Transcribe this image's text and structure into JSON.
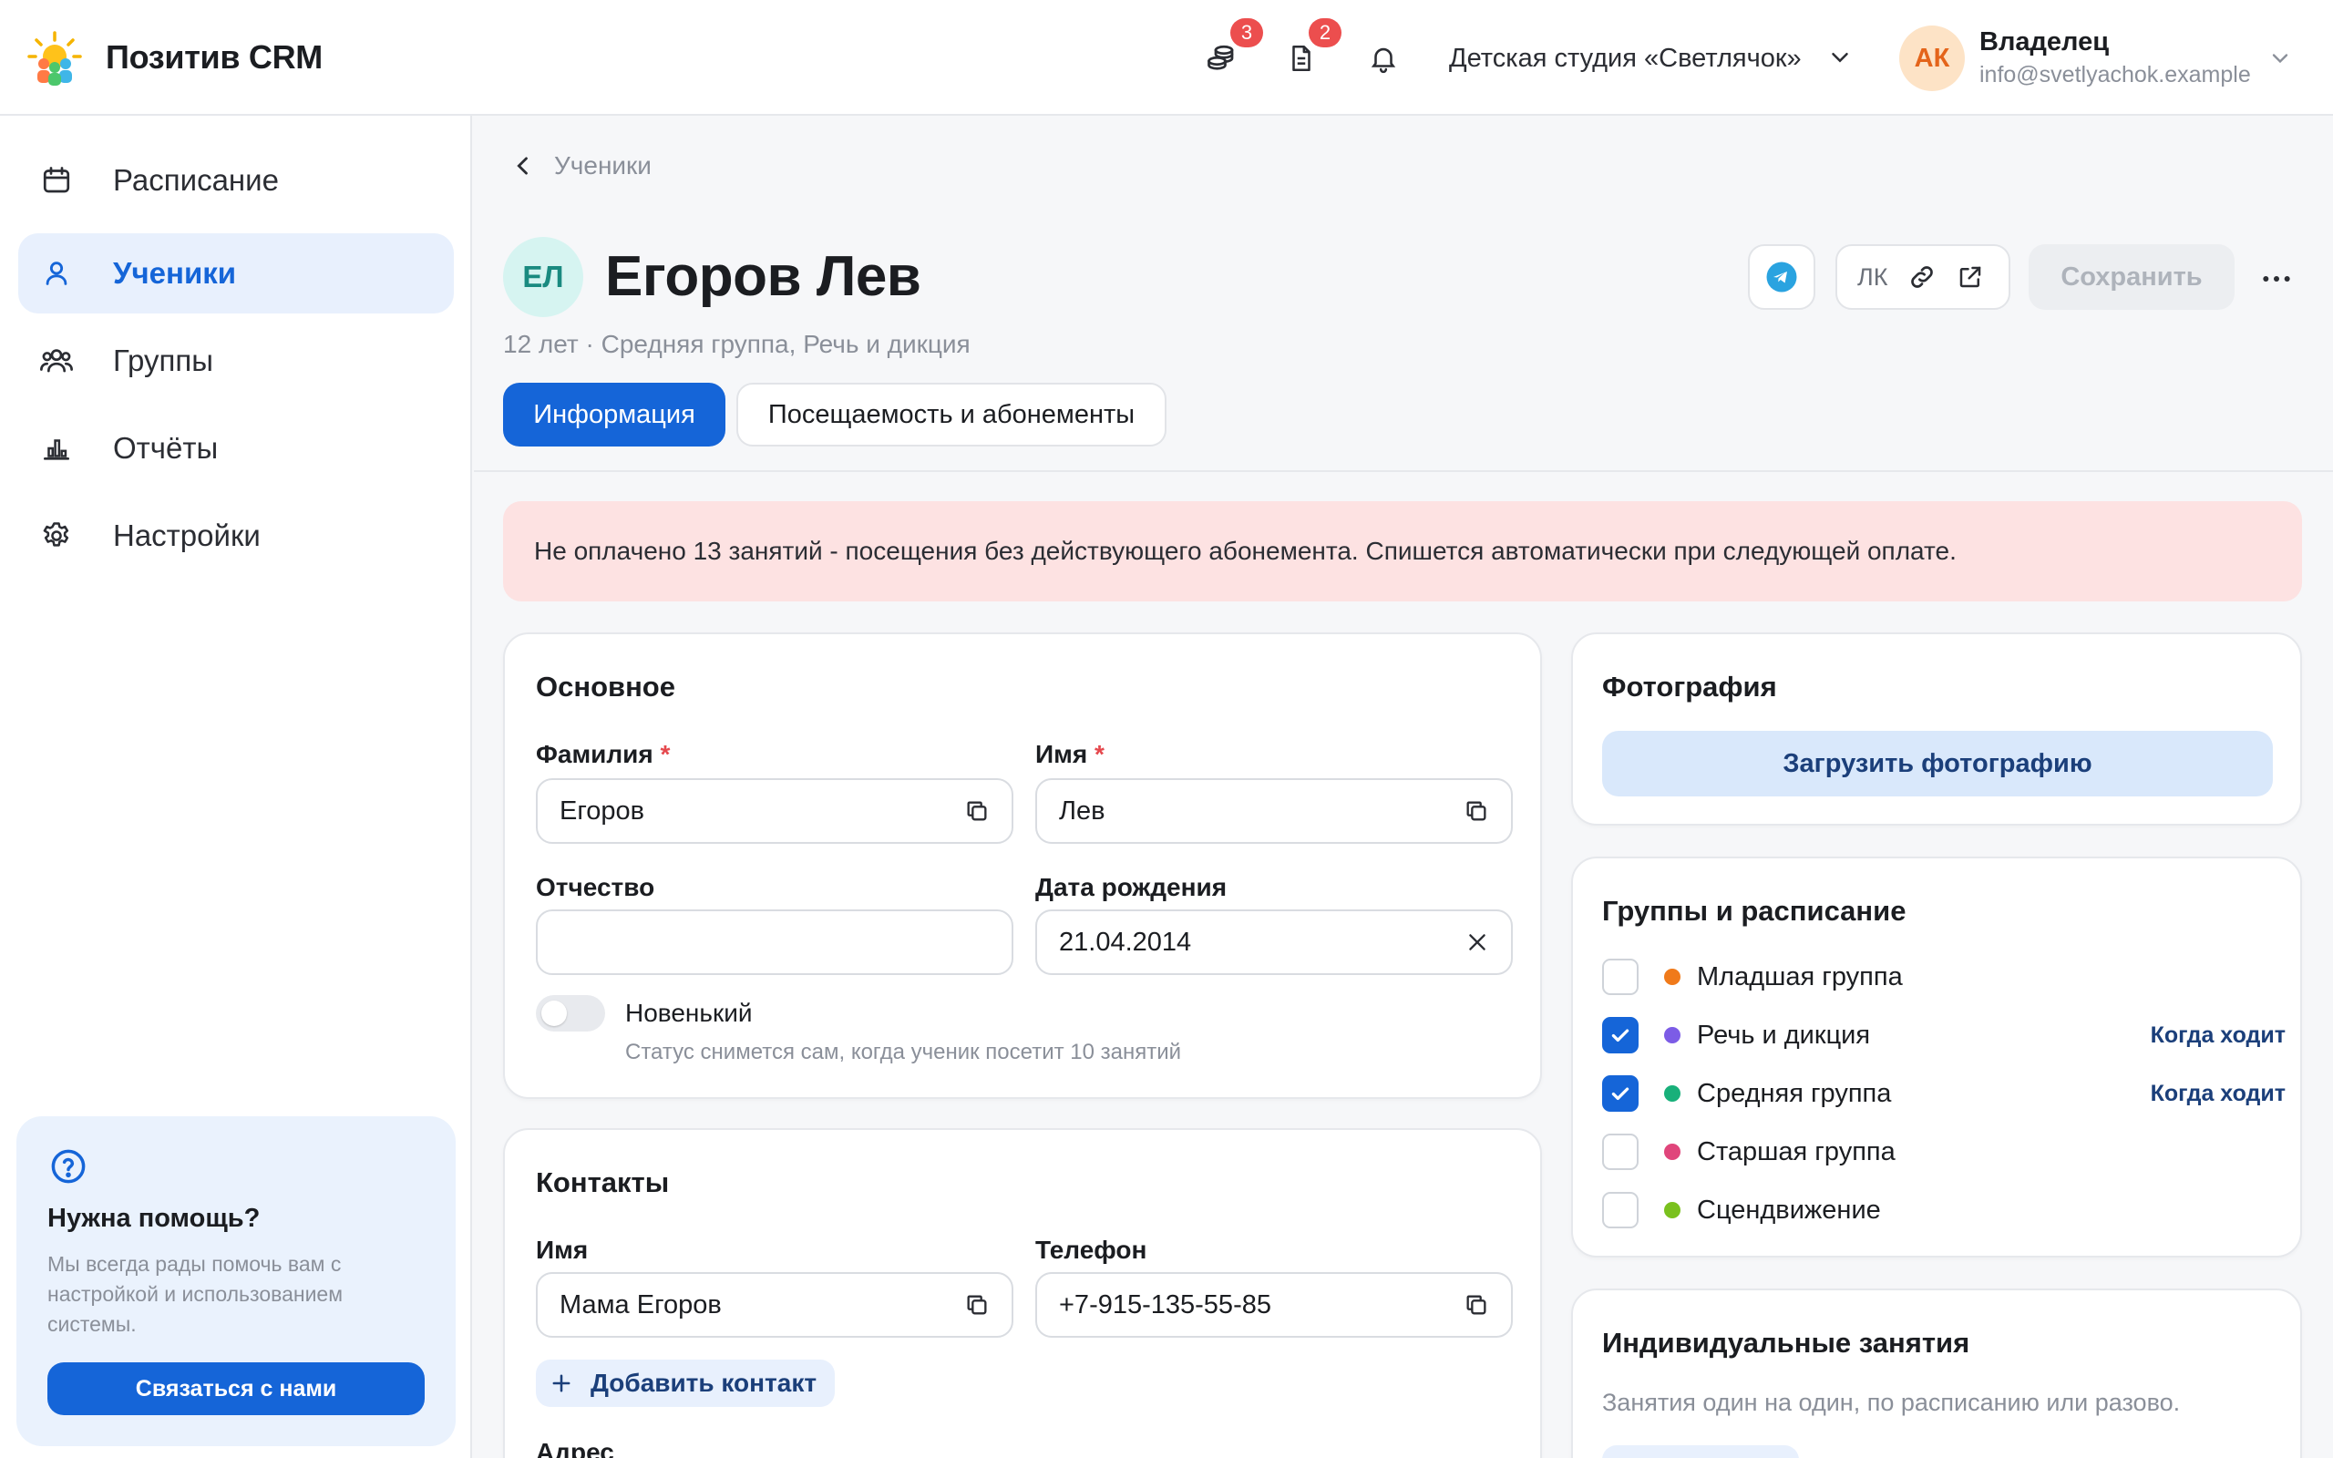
{
  "app": {
    "name": "Позитив CRM"
  },
  "header": {
    "finance_badge": "3",
    "docs_badge": "2",
    "org_name": "Детская студия «Светлячок»",
    "user": {
      "initials": "АК",
      "role": "Владелец",
      "email": "info@svetlyachok.example"
    }
  },
  "sidebar": {
    "items": [
      {
        "label": "Расписание",
        "icon": "calendar-icon"
      },
      {
        "label": "Ученики",
        "icon": "user-icon",
        "active": true
      },
      {
        "label": "Группы",
        "icon": "users-icon"
      },
      {
        "label": "Отчёты",
        "icon": "chart-icon"
      },
      {
        "label": "Настройки",
        "icon": "gear-icon"
      }
    ],
    "help": {
      "title": "Нужна помощь?",
      "text": "Мы всегда рады помочь вам с настройкой и использованием системы.",
      "button": "Связаться с нами"
    }
  },
  "breadcrumb": {
    "back_label": "Ученики"
  },
  "student": {
    "initials": "ЕЛ",
    "name": "Егоров Лев",
    "subtitle": "12 лет · Средняя группа, Речь и дикция"
  },
  "actions": {
    "lk_label": "ЛК",
    "save_label": "Сохранить"
  },
  "tabs": [
    {
      "label": "Информация",
      "active": true
    },
    {
      "label": "Посещаемость и абонементы"
    }
  ],
  "alert": {
    "text": "Не оплачено 13 занятий - посещения без действующего абонемента. Спишется автоматически при следующей оплате."
  },
  "basic": {
    "title": "Основное",
    "last_name": {
      "label": "Фамилия",
      "required": "*",
      "value": "Егоров"
    },
    "first_name": {
      "label": "Имя",
      "required": "*",
      "value": "Лев"
    },
    "patronymic": {
      "label": "Отчество",
      "value": ""
    },
    "birth_date": {
      "label": "Дата рождения",
      "value": "21.04.2014"
    },
    "newbie": {
      "label": "Новенький",
      "hint": "Статус снимется сам, когда ученик посетит 10 занятий",
      "on": false
    }
  },
  "contacts": {
    "title": "Контакты",
    "name": {
      "label": "Имя",
      "value": "Мама Егоров"
    },
    "phone": {
      "label": "Телефон",
      "value": "+7-915-135-55-85"
    },
    "add_label": "Добавить контакт",
    "address_label": "Адрес"
  },
  "photo": {
    "title": "Фотография",
    "upload_label": "Загрузить фотографию"
  },
  "groups": {
    "title": "Группы и расписание",
    "when_label": "Когда ходит",
    "items": [
      {
        "name": "Младшая группа",
        "checked": false,
        "color": "#f07a1a"
      },
      {
        "name": "Речь и дикция",
        "checked": true,
        "color": "#7c5ce6"
      },
      {
        "name": "Средняя группа",
        "checked": true,
        "color": "#18b07a"
      },
      {
        "name": "Старшая группа",
        "checked": false,
        "color": "#e0457b"
      },
      {
        "name": "Сцендвижение",
        "checked": false,
        "color": "#7ac11e"
      }
    ]
  },
  "individual": {
    "title": "Индивидуальные занятия",
    "text": "Занятия один на один, по расписанию или разово."
  },
  "colors": {
    "accent": "#1565d8",
    "alert_bg": "#fde2e2",
    "badge": "#ec4e4e"
  }
}
